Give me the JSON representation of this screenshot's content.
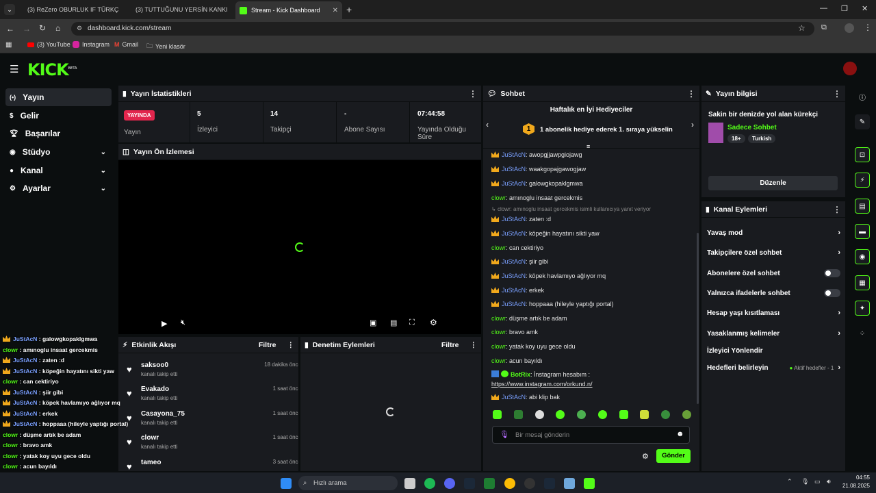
{
  "browser": {
    "tabs": [
      {
        "title": "(3) ReZero OBURLUK IF TÜRKÇ",
        "icon": "youtube-icon"
      },
      {
        "title": "(3) TUTTUĞUNU YERSİN KANKI",
        "icon": "youtube-icon"
      },
      {
        "title": "Stream - Kick Dashboard",
        "icon": "kick-icon"
      }
    ],
    "url": "dashboard.kick.com/stream",
    "bookmarks": [
      "(3) YouTube",
      "Instagram",
      "Gmail",
      "Yeni klasör"
    ]
  },
  "kick": {
    "logo": "KICK",
    "logo_tag": "BETA"
  },
  "sidebar": {
    "items": [
      {
        "label": "Yayın",
        "icon": "broadcast-icon"
      },
      {
        "label": "Gelir",
        "icon": "money-icon"
      },
      {
        "label": "Başarılar",
        "icon": "trophy-icon"
      },
      {
        "label": "Stüdyo",
        "icon": "camera-icon"
      },
      {
        "label": "Kanal",
        "icon": "user-icon"
      },
      {
        "label": "Ayarlar",
        "icon": "gear-icon"
      }
    ]
  },
  "stats": {
    "title": "Yayın İstatistikleri",
    "status_badge": "YAYINDA",
    "status_label": "Yayın",
    "viewers": "5",
    "viewers_label": "İzleyici",
    "followers": "14",
    "followers_label": "Takipçi",
    "subs": "-",
    "subs_label": "Abone Sayısı",
    "duration": "07:44:58",
    "duration_label": "Yayında Olduğu Süre"
  },
  "preview": {
    "title": "Yayın Ön İzlemesi"
  },
  "activity": {
    "title": "Etkinlik Akışı",
    "filter": "Filtre",
    "items": [
      {
        "name": "saksoo0",
        "sub": "kanalı takip etti",
        "time": "18 dakika önce"
      },
      {
        "name": "Evakado",
        "sub": "kanalı takip etti",
        "time": "1 saat önce"
      },
      {
        "name": "Casayona_75",
        "sub": "kanalı takip etti",
        "time": "1 saat önce"
      },
      {
        "name": "clowr",
        "sub": "kanalı takip etti",
        "time": "1 saat önce"
      },
      {
        "name": "tameo",
        "sub": "",
        "time": "3 saat önce"
      }
    ]
  },
  "moderation": {
    "title": "Denetim Eylemleri",
    "filter": "Filtre"
  },
  "chat": {
    "title": "Sohbet",
    "gifters_title": "Haftalık en İyi Hediyeciler",
    "gifters_rank": "1",
    "gifters_text": "1 abonelik hediye ederek 1. sıraya yükselin",
    "reply_note": "clowr: amınoglu insaat gercekmis isimli kullanıcıya yanıt veriyor",
    "messages": [
      {
        "user": "JuStAcN",
        "text": ": awopgjjawpgiojawg",
        "badge": true
      },
      {
        "user": "JuStAcN",
        "text": ": waakgopajgawogjaw",
        "badge": true
      },
      {
        "user": "JuStAcN",
        "text": ": galowgkopaklgmwa",
        "badge": true
      },
      {
        "user": "clowr",
        "text": ": amınoglu insaat gercekmis",
        "badge": false
      },
      {
        "user": "JuStAcN",
        "text": ": zaten :d",
        "badge": true
      },
      {
        "user": "JuStAcN",
        "text": ": köpeğin hayatını sikti yaw",
        "badge": true
      },
      {
        "user": "clowr",
        "text": ": can cektiriyo",
        "badge": false
      },
      {
        "user": "JuStAcN",
        "text": ": şiir gibi",
        "badge": true
      },
      {
        "user": "JuStAcN",
        "text": ": köpek havlamıyo ağlıyor mq",
        "badge": true
      },
      {
        "user": "JuStAcN",
        "text": ": erkek",
        "badge": true
      },
      {
        "user": "JuStAcN",
        "text": ": hoppaaa (hileyle yaptığı portal)",
        "badge": true
      },
      {
        "user": "clowr",
        "text": ": düşme artık be adam",
        "badge": false
      },
      {
        "user": "clowr",
        "text": ": bravo amk",
        "badge": false
      },
      {
        "user": "clowr",
        "text": ": yatak koy uyu gece oldu",
        "badge": false
      },
      {
        "user": "clowr",
        "text": ": acun bayıldı",
        "badge": false
      }
    ],
    "bot_user": "BotRix",
    "bot_text": ": İnstagram hesabım :",
    "bot_link": "https://www.instagram.com/orkund.n/",
    "last_user": "JuStAcN",
    "last_text": ": abi klip bak",
    "input_placeholder": "Bir mesaj gönderin",
    "send": "Gönder"
  },
  "stream_info": {
    "title": "Yayın bilgisi",
    "stream_title": "Sakin bir denizde yol alan kürekçi",
    "category": "Sadece Sohbet",
    "tags": [
      "18+",
      "Turkish"
    ],
    "edit": "Düzenle"
  },
  "channel_actions": {
    "title": "Kanal Eylemleri",
    "items": [
      {
        "label": "Yavaş mod",
        "type": "chevron"
      },
      {
        "label": "Takipçilere özel sohbet",
        "type": "chevron"
      },
      {
        "label": "Abonelere özel sohbet",
        "type": "toggle"
      },
      {
        "label": "Yalnızca ifadelerle sohbet",
        "type": "toggle"
      },
      {
        "label": "Hesap yaşı kısıtlaması",
        "type": "chevron"
      },
      {
        "label": "Yasaklanmış kelimeler",
        "type": "chevron"
      },
      {
        "label": "İzleyici Yönlendir",
        "type": "none"
      },
      {
        "label": "Hedefleri belirleyin",
        "type": "goal"
      }
    ],
    "goal_text": "Aktif hedefler - 1"
  },
  "overlay_chat": [
    {
      "user": "JuStAcN",
      "text": " : galowgkopaklgmwa"
    },
    {
      "user": "clowr",
      "text": " : amınoglu insaat gercekmis"
    },
    {
      "user": "JuStAcN",
      "text": " : zaten :d"
    },
    {
      "user": "JuStAcN",
      "text": " : köpeğin hayatını sikti yaw"
    },
    {
      "user": "clowr",
      "text": " : can cektiriyo"
    },
    {
      "user": "JuStAcN",
      "text": " : şiir gibi"
    },
    {
      "user": "JuStAcN",
      "text": " : köpek havlamıyo ağlıyor mq"
    },
    {
      "user": "JuStAcN",
      "text": " : erkek"
    },
    {
      "user": "JuStAcN",
      "text": " : hoppaaa (hileyle yaptığı portal)"
    },
    {
      "user": "clowr",
      "text": " : düşme artık be adam"
    },
    {
      "user": "clowr",
      "text": " : bravo amk"
    },
    {
      "user": "clowr",
      "text": " : yatak koy uyu gece oldu"
    },
    {
      "user": "clowr",
      "text": " : acun bayıldı"
    },
    {
      "user": "BotRix",
      "text": " : İnstagram hesabım : https://www.instagram.com/orkund.n/"
    },
    {
      "user": "JuStAcN",
      "text": " : abi klip bak"
    }
  ],
  "taskbar": {
    "search": "Hızlı arama",
    "time": "04:55",
    "date": "21.08.2025"
  },
  "colors": {
    "brand": "#53fc18",
    "live": "#e2264d",
    "panel": "#191b1f",
    "bg": "#0b0e0f"
  }
}
